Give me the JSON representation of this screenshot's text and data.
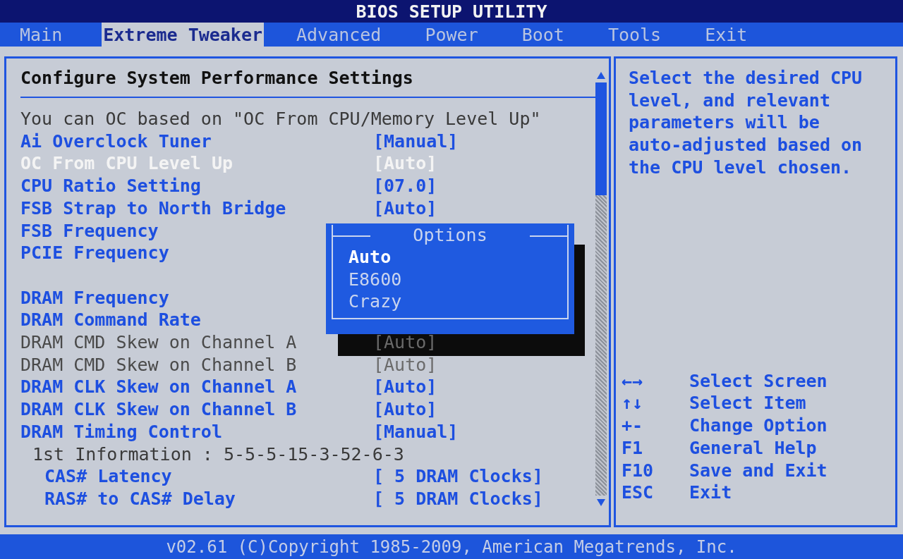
{
  "window": {
    "title": "BIOS SETUP UTILITY"
  },
  "tabs": [
    {
      "label": "Main",
      "selected": false
    },
    {
      "label": "Extreme Tweaker",
      "selected": true
    },
    {
      "label": "Advanced",
      "selected": false
    },
    {
      "label": "Power",
      "selected": false
    },
    {
      "label": "Boot",
      "selected": false
    },
    {
      "label": "Tools",
      "selected": false
    },
    {
      "label": "Exit",
      "selected": false
    }
  ],
  "settings_panel": {
    "heading": "Configure System Performance Settings",
    "items": [
      {
        "kind": "note",
        "label": "You can OC based on \"OC From CPU/Memory Level Up\""
      },
      {
        "kind": "setting",
        "label": "Ai Overclock Tuner",
        "value": "[Manual]",
        "selected": false,
        "disabled": false
      },
      {
        "kind": "setting",
        "label": "OC From CPU Level Up",
        "value": "[Auto]",
        "selected": true,
        "disabled": false
      },
      {
        "kind": "setting",
        "label": "CPU Ratio Setting",
        "value": "[07.0]",
        "selected": false,
        "disabled": false
      },
      {
        "kind": "setting",
        "label": "FSB Strap to North Bridge",
        "value": "[Auto]",
        "selected": false,
        "disabled": false
      },
      {
        "kind": "setting",
        "label": "FSB Frequency",
        "selected": false,
        "disabled": false
      },
      {
        "kind": "setting",
        "label": "PCIE Frequency",
        "selected": false,
        "disabled": false
      },
      {
        "kind": "setting",
        "label": "DRAM Frequency",
        "selected": false,
        "disabled": false,
        "gap_before": true
      },
      {
        "kind": "setting",
        "label": "DRAM Command Rate",
        "selected": false,
        "disabled": false
      },
      {
        "kind": "setting",
        "label": "DRAM CMD Skew on Channel A",
        "value": "[Auto]",
        "selected": false,
        "disabled": true
      },
      {
        "kind": "setting",
        "label": "DRAM CMD Skew on Channel B",
        "value": "[Auto]",
        "selected": false,
        "disabled": true
      },
      {
        "kind": "setting",
        "label": "DRAM CLK Skew on Channel A",
        "value": "[Auto]",
        "selected": false,
        "disabled": false
      },
      {
        "kind": "setting",
        "label": "DRAM CLK Skew on Channel B",
        "value": "[Auto]",
        "selected": false,
        "disabled": false
      },
      {
        "kind": "setting",
        "label": "DRAM Timing Control",
        "value": "[Manual]",
        "selected": false,
        "disabled": false,
        "children": [
          {
            "kind": "note",
            "label": "1st Information : 5-5-5-15-3-52-6-3",
            "children": [
              {
                "kind": "setting",
                "label": "CAS# Latency",
                "value": "[ 5 DRAM Clocks]",
                "selected": false,
                "disabled": false
              },
              {
                "kind": "setting",
                "label": "RAS# to CAS# Delay",
                "value": "[ 5 DRAM Clocks]",
                "selected": false,
                "disabled": false
              }
            ]
          }
        ]
      }
    ]
  },
  "options_popup": {
    "title": "Options",
    "options": [
      {
        "label": "Auto",
        "selected": true
      },
      {
        "label": "E8600",
        "selected": false
      },
      {
        "label": "Crazy",
        "selected": false
      }
    ]
  },
  "help_panel": {
    "text": "Select the desired CPU level, and relevant parameters will be auto-adjusted based on the CPU level chosen.",
    "keys": [
      {
        "key": "←→",
        "action": "Select Screen"
      },
      {
        "key": "↑↓",
        "action": "Select Item"
      },
      {
        "key": "+-",
        "action": "Change Option"
      },
      {
        "key": "F1",
        "action": "General Help"
      },
      {
        "key": "F10",
        "action": "Save and Exit"
      },
      {
        "key": "ESC",
        "action": "Exit"
      }
    ]
  },
  "status_bar": {
    "text": "v02.61 (C)Copyright 1985-2009, American Megatrends, Inc."
  }
}
